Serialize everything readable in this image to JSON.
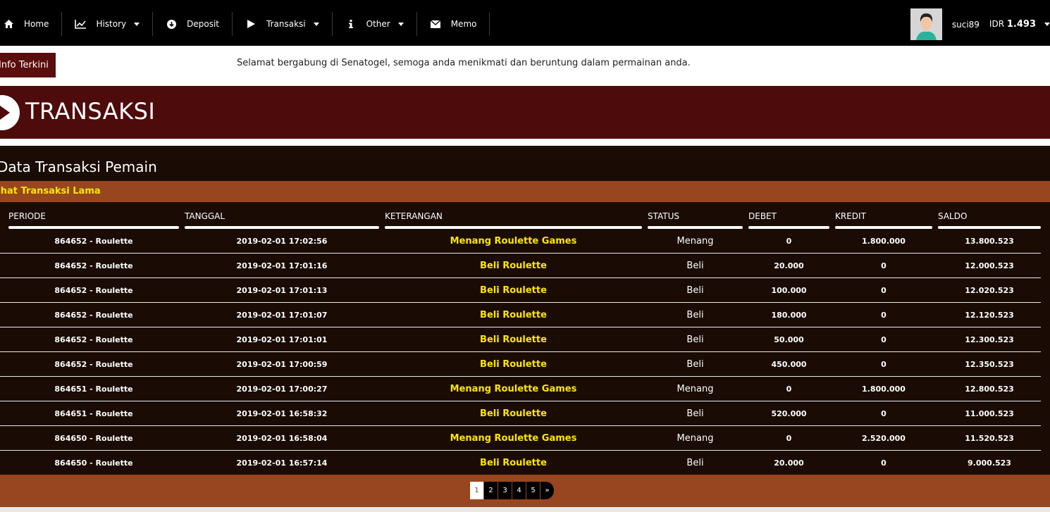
{
  "nav": {
    "items": [
      {
        "label": "Home",
        "icon": "home-icon",
        "dropdown": false
      },
      {
        "label": "History",
        "icon": "chart-line-icon",
        "dropdown": true
      },
      {
        "label": "Deposit",
        "icon": "download-circle-icon",
        "dropdown": false
      },
      {
        "label": "Transaksi",
        "icon": "play-icon",
        "dropdown": true
      },
      {
        "label": "Other",
        "icon": "info-icon",
        "dropdown": true
      },
      {
        "label": "Memo",
        "icon": "envelope-icon",
        "dropdown": false
      }
    ],
    "username": "suci89",
    "currency": "IDR",
    "balance": "1.493"
  },
  "info": {
    "badge": "Info Terkini",
    "message": "Selamat bergabung di Senatogel, semoga anda menikmati dan beruntung dalam permainan anda."
  },
  "banner": {
    "title": "TRANSAKSI"
  },
  "panel": {
    "title": "Data Transaksi Pemain",
    "subtitle": "Lihat Transaksi Lama"
  },
  "table": {
    "headers": [
      "PERIODE",
      "TANGGAL",
      "KETERANGAN",
      "STATUS",
      "DEBET",
      "KREDIT",
      "SALDO"
    ],
    "rows": [
      [
        "864652 - Roulette",
        "2019-02-01 17:02:56",
        "Menang Roulette Games",
        "Menang",
        "0",
        "1.800.000",
        "13.800.523"
      ],
      [
        "864652 - Roulette",
        "2019-02-01 17:01:16",
        "Beli Roulette",
        "Beli",
        "20.000",
        "0",
        "12.000.523"
      ],
      [
        "864652 - Roulette",
        "2019-02-01 17:01:13",
        "Beli Roulette",
        "Beli",
        "100.000",
        "0",
        "12.020.523"
      ],
      [
        "864652 - Roulette",
        "2019-02-01 17:01:07",
        "Beli Roulette",
        "Beli",
        "180.000",
        "0",
        "12.120.523"
      ],
      [
        "864652 - Roulette",
        "2019-02-01 17:01:01",
        "Beli Roulette",
        "Beli",
        "50.000",
        "0",
        "12.300.523"
      ],
      [
        "864652 - Roulette",
        "2019-02-01 17:00:59",
        "Beli Roulette",
        "Beli",
        "450.000",
        "0",
        "12.350.523"
      ],
      [
        "864651 - Roulette",
        "2019-02-01 17:00:27",
        "Menang Roulette Games",
        "Menang",
        "0",
        "1.800.000",
        "12.800.523"
      ],
      [
        "864651 - Roulette",
        "2019-02-01 16:58:32",
        "Beli Roulette",
        "Beli",
        "520.000",
        "0",
        "11.000.523"
      ],
      [
        "864650 - Roulette",
        "2019-02-01 16:58:04",
        "Menang Roulette Games",
        "Menang",
        "0",
        "2.520.000",
        "11.520.523"
      ],
      [
        "864650 - Roulette",
        "2019-02-01 16:57:14",
        "Beli Roulette",
        "Beli",
        "20.000",
        "0",
        "9.000.523"
      ]
    ]
  },
  "pagination": {
    "pages": [
      "1",
      "2",
      "3",
      "4",
      "5"
    ],
    "current": "1",
    "next": "»"
  },
  "colors": {
    "banner": "#4e0b0b",
    "panel": "#1a0c04",
    "accent_bar": "#97461f",
    "highlight_text": "#ffe600"
  }
}
